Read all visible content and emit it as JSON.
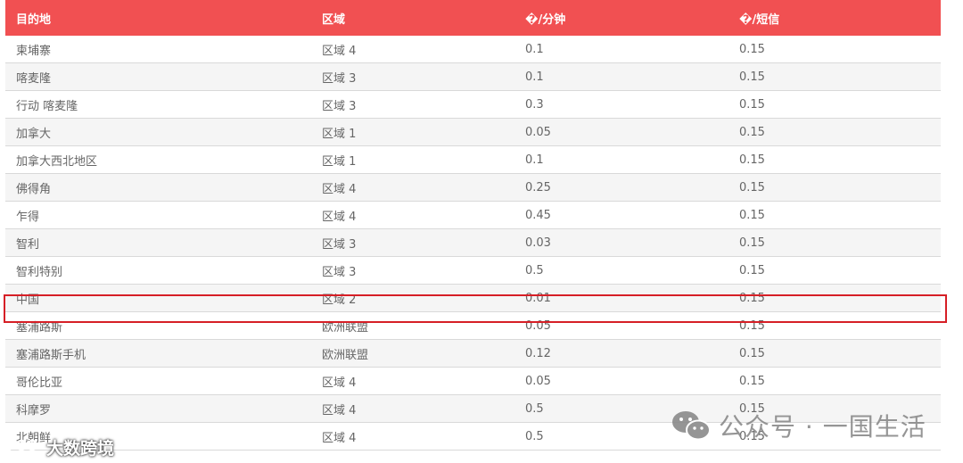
{
  "table": {
    "headers": [
      "目的地",
      "区域",
      "�/分钟",
      "�/短信"
    ],
    "rows": [
      [
        "柬埔寨",
        "区域 4",
        "0.1",
        "0.15"
      ],
      [
        "喀麦隆",
        "区域 3",
        "0.1",
        "0.15"
      ],
      [
        "行动 喀麦隆",
        "区域 3",
        "0.3",
        "0.15"
      ],
      [
        "加拿大",
        "区域 1",
        "0.05",
        "0.15"
      ],
      [
        "加拿大西北地区",
        "区域 1",
        "0.1",
        "0.15"
      ],
      [
        "佛得角",
        "区域 4",
        "0.25",
        "0.15"
      ],
      [
        "乍得",
        "区域 4",
        "0.45",
        "0.15"
      ],
      [
        "智利",
        "区域 3",
        "0.03",
        "0.15"
      ],
      [
        "智利特别",
        "区域 3",
        "0.5",
        "0.15"
      ],
      [
        "中国",
        "区域 2",
        "0.01",
        "0.15"
      ],
      [
        "塞浦路斯",
        "欧洲联盟",
        "0.05",
        "0.15"
      ],
      [
        "塞浦路斯手机",
        "欧洲联盟",
        "0.12",
        "0.15"
      ],
      [
        "哥伦比亚",
        "区域 4",
        "0.05",
        "0.15"
      ],
      [
        "科摩罗",
        "区域 4",
        "0.5",
        "0.15"
      ],
      [
        "北朝鲜",
        "区域 4",
        "0.5",
        "0.15"
      ]
    ],
    "highlighted_row": "中国"
  },
  "watermarks": {
    "right": "公众号 · 一国生活",
    "left": "大数跨境"
  },
  "colors": {
    "header_bg": "#f15052",
    "highlight_border": "#d61f26",
    "row_alt_bg": "#f5f5f5"
  },
  "icons": {
    "right_watermark": "wechat-icon",
    "left_watermark": "brand-logo-icon"
  }
}
